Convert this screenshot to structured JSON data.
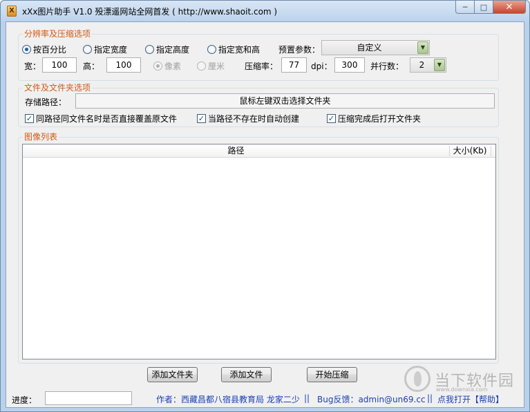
{
  "window": {
    "title": "xXx图片助手 V1.0  殁漂遥网站全网首发 ( http://www.shaoit.com )",
    "icon": "app-icon"
  },
  "resolution_group": {
    "title": "分辨率及压缩选项",
    "radios": [
      {
        "label": "按百分比",
        "checked": true
      },
      {
        "label": "指定宽度",
        "checked": false
      },
      {
        "label": "指定高度",
        "checked": false
      },
      {
        "label": "指定宽和高",
        "checked": false
      }
    ],
    "preset_label": "预置参数：",
    "preset_value": "自定义",
    "width_label": "宽：",
    "width_value": "100",
    "height_label": "高：",
    "height_value": "100",
    "unit_pixel": "像素",
    "unit_cm": "厘米",
    "compress_label": "压缩率：",
    "compress_value": "77",
    "dpi_label": "dpi：",
    "dpi_value": "300",
    "threads_label": "并行数：",
    "threads_value": "2"
  },
  "folder_group": {
    "title": "文件及文件夹选项",
    "save_path_label": "存储路径：",
    "save_path_value": "鼠标左键双击选择文件夹",
    "checks": [
      {
        "label": "同路径同文件名时是否直接覆盖原文件",
        "checked": true
      },
      {
        "label": "当路径不存在时自动创建",
        "checked": true
      },
      {
        "label": "压缩完成后打开文件夹",
        "checked": true
      }
    ]
  },
  "image_list": {
    "title": "图像列表",
    "columns": [
      "路径",
      "大小(Kb)"
    ]
  },
  "buttons": {
    "add_folder": "添加文件夹",
    "add_file": "添加文件",
    "start": "开始压缩"
  },
  "status": {
    "progress_label": "进度：",
    "progress_value": "",
    "author": "作者：西藏昌都八宿县教育局 龙家二少",
    "sep1": "||",
    "bug": "Bug反馈：admin@un69.cc",
    "sep2": "||",
    "help": "点我打开【帮助】"
  },
  "watermark": {
    "text": "当下软件园",
    "sub": "www.downxia.com"
  }
}
